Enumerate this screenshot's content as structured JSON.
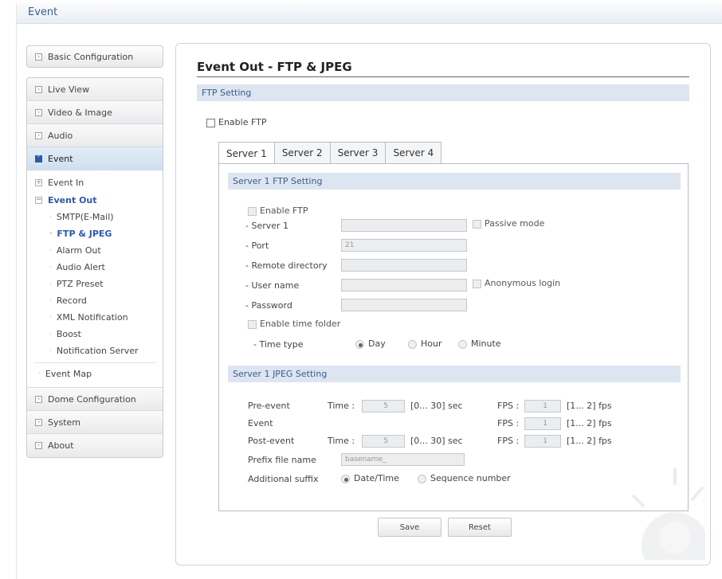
{
  "window": {
    "title": "Event"
  },
  "sidebar": {
    "basic_config": "Basic Configuration",
    "items": [
      {
        "label": "Live View"
      },
      {
        "label": "Video & Image"
      },
      {
        "label": "Audio"
      },
      {
        "label": "Event"
      }
    ],
    "event_in": "Event In",
    "event_out": "Event Out",
    "event_out_items": [
      {
        "label": "SMTP(E-Mail)"
      },
      {
        "label": "FTP & JPEG"
      },
      {
        "label": "Alarm Out"
      },
      {
        "label": "Audio Alert"
      },
      {
        "label": "PTZ Preset"
      },
      {
        "label": "Record"
      },
      {
        "label": "XML Notification"
      },
      {
        "label": "Boost"
      },
      {
        "label": "Notification Server"
      }
    ],
    "event_map": "Event Map",
    "bottom_items": [
      {
        "label": "Dome Configuration"
      },
      {
        "label": "System"
      },
      {
        "label": "About"
      }
    ]
  },
  "main": {
    "title": "Event Out - FTP & JPEG",
    "ftp_setting_header": "FTP Setting",
    "enable_ftp_label": "Enable FTP",
    "tabs": [
      {
        "label": "Server 1"
      },
      {
        "label": "Server 2"
      },
      {
        "label": "Server 3"
      },
      {
        "label": "Server 4"
      }
    ],
    "server_ftp_header": "Server 1 FTP Setting",
    "server": {
      "enable_ftp": "Enable FTP",
      "server_label": "- Server 1",
      "server_value": "",
      "passive_mode": "Passive mode",
      "port_label": "- Port",
      "port_value": "21",
      "remote_dir_label": "- Remote directory",
      "remote_dir_value": "",
      "username_label": "- User name",
      "username_value": "",
      "anonymous_login": "Anonymous login",
      "password_label": "- Password",
      "password_value": "",
      "enable_time_folder": "Enable time folder",
      "time_type_label": "- Time type",
      "time_type_options": [
        "Day",
        "Hour",
        "Minute"
      ],
      "time_type_selected": "Day"
    },
    "server_jpeg_header": "Server 1 JPEG Setting",
    "jpeg": {
      "pre_event_label": "Pre-event",
      "event_label": "Event",
      "post_event_label": "Post-event",
      "time_label": "Time :",
      "fps_label": "FPS :",
      "pre_time": "5",
      "post_time": "5",
      "time_range": "[0... 30] sec",
      "fps_range": "[1... 2] fps",
      "pre_fps": "1",
      "event_fps": "1",
      "post_fps": "1",
      "prefix_label": "Prefix file name",
      "prefix_value": "basename_",
      "suffix_label": "Additional suffix",
      "suffix_options": [
        "Date/Time",
        "Sequence number"
      ],
      "suffix_selected": "Date/Time"
    },
    "save_label": "Save",
    "reset_label": "Reset"
  },
  "colors": {
    "accent": "#2d5aa8",
    "section_bar": "#dde5f1",
    "section_text": "#3a5c8c"
  }
}
